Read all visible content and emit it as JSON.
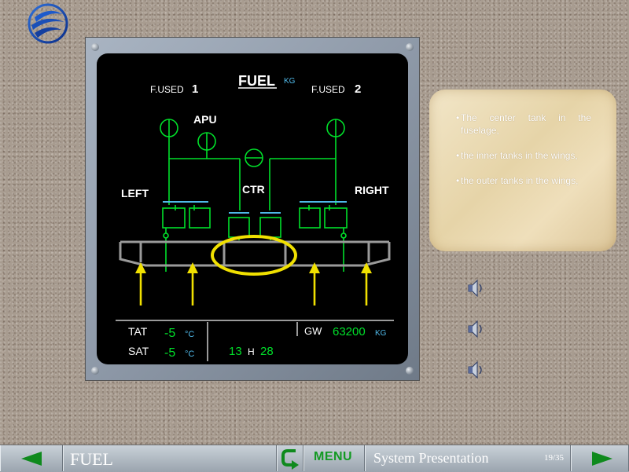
{
  "ecam": {
    "title": "FUEL",
    "title_unit": "KG",
    "fused1_label": "F.USED",
    "fused1_num": "1",
    "fused2_label": "F.USED",
    "fused2_num": "2",
    "apu_label": "APU",
    "ctr_label": "CTR",
    "left_label": "LEFT",
    "right_label": "RIGHT",
    "tat_label": "TAT",
    "tat_value": "-5",
    "sat_label": "SAT",
    "sat_value": "-5",
    "temp_unit": "°C",
    "time_hours": "13",
    "time_h": "H",
    "time_minutes": "28",
    "gw_label": "GW",
    "gw_value": "63200",
    "gw_unit": "KG",
    "colors": {
      "green": "#00e02a",
      "white": "#ffffff",
      "cyan": "#4fb8e8",
      "yellow": "#f0e000",
      "grey": "#9a9a9a"
    }
  },
  "info_card": {
    "items": [
      "The center tank in the fuselage,",
      "the inner tanks in the wings,",
      "the outer tanks in the wings,"
    ]
  },
  "speakers": [
    "speaker-icon",
    "speaker-icon",
    "speaker-icon"
  ],
  "nav": {
    "section_title": "FUEL",
    "menu_label": "MENU",
    "presentation_title": "System Presentation",
    "page_number": "19/35",
    "accent_color": "#0f8a1d"
  }
}
